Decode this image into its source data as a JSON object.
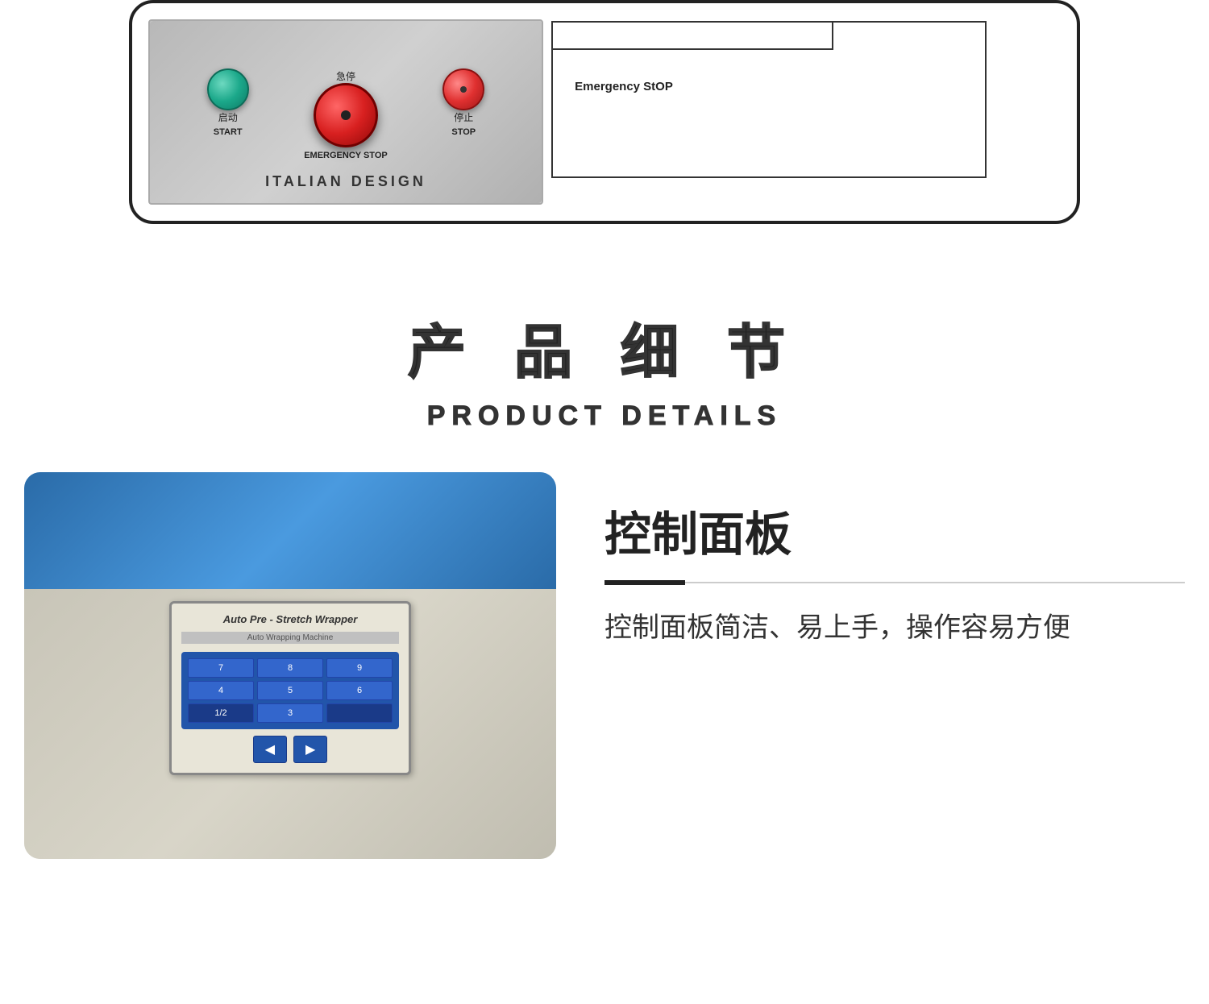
{
  "top": {
    "panel_label_start_cn": "启动",
    "panel_label_start_en": "START",
    "panel_label_stop_cn": "停止",
    "panel_label_stop_en": "STOP",
    "panel_label_emergency_cn": "急停",
    "panel_label_emergency_en": "EMERGENCY STOP",
    "panel_brand": "ITALIAN  DESIGN",
    "emergency_stop_title": "Emergency StOP"
  },
  "product_details": {
    "title_cn": "产 品 细 节",
    "title_en": "PRODUCT DETAILS"
  },
  "control_panel_section": {
    "title": "控制面板",
    "divider_decoration": "——",
    "description": "控制面板简洁、易上手，操作容易方便",
    "machine_title": "Auto Pre - Stretch Wrapper",
    "machine_subtitle": "Auto Wrapping Machine",
    "keypad_keys": [
      "7",
      "8",
      "9",
      "4",
      "5",
      "6",
      "1/2",
      "3",
      ""
    ],
    "nav_left": "◀",
    "nav_right": "▶"
  }
}
